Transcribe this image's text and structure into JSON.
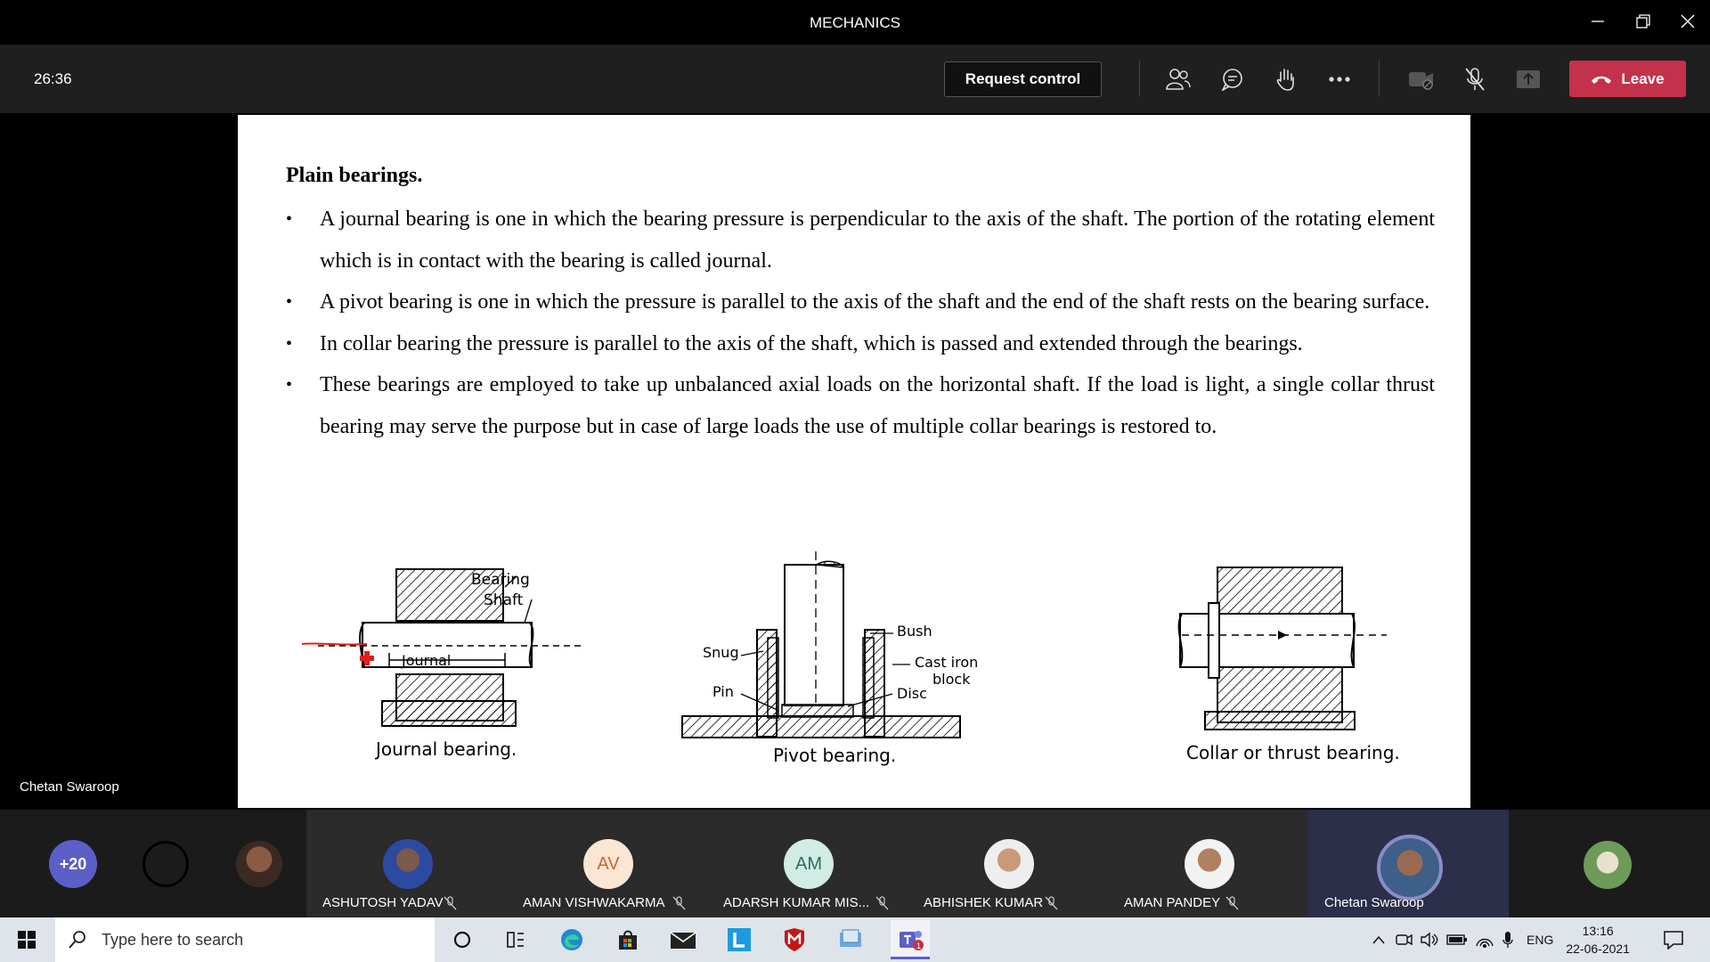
{
  "window": {
    "title": "MECHANICS"
  },
  "toolbar": {
    "timer": "26:36",
    "request_control": "Request control",
    "leave": "Leave",
    "icons": [
      "participants-icon",
      "chat-icon",
      "raise-hand-icon",
      "more-icon",
      "camera-off-icon",
      "mic-muted-icon",
      "share-icon"
    ]
  },
  "stage": {
    "presenter_label": "Chetan Swaroop"
  },
  "slide": {
    "heading": "Plain bearings.",
    "bullets": [
      "A journal bearing is one in which the bearing pressure is perpendicular to the axis of the shaft. The portion of the rotating element which is in contact with the bearing is called journal.",
      "A pivot bearing is one in which the pressure is parallel to the axis of the shaft and the end of the shaft rests on the bearing surface.",
      "In collar bearing the pressure is parallel to the axis of the shaft, which is passed and extended through the bearings.",
      "These bearings are employed to take up unbalanced axial loads on the horizontal shaft. If the load is light, a single collar thrust bearing may serve the purpose but in case of large loads the use of multiple collar bearings is restored to."
    ],
    "diagrams": {
      "journal": {
        "caption": "Journal bearing.",
        "bearing": "Bearing",
        "shaft": "Shaft",
        "journal": "Journal"
      },
      "pivot": {
        "caption": "Pivot bearing.",
        "bush": "Bush",
        "snug": "Snug",
        "cast_iron": "Cast iron",
        "block": "block",
        "pin": "Pin",
        "disc": "Disc"
      },
      "collar": {
        "caption": "Collar or thrust bearing."
      }
    }
  },
  "participants": {
    "overflow": "+20",
    "people": [
      {
        "name": "ASHUTOSH YADAV",
        "initials": "",
        "muted": true
      },
      {
        "name": "AMAN VISHWAKARMA",
        "initials": "AV",
        "muted": true
      },
      {
        "name": "ADARSH KUMAR MIS...",
        "initials": "AM",
        "muted": true
      },
      {
        "name": "ABHISHEK KUMAR",
        "initials": "",
        "muted": true
      },
      {
        "name": "AMAN PANDEY",
        "initials": "",
        "muted": true
      },
      {
        "name": "Chetan Swaroop",
        "initials": "",
        "muted": false
      }
    ]
  },
  "taskbar": {
    "search_placeholder": "Type here to search",
    "language": "ENG",
    "time": "13:16",
    "date": "22-06-2021",
    "teams_badge": "1"
  },
  "colors": {
    "leave": "#c4314b",
    "toolbar": "#1f1f1f",
    "strip": "#1b1b1b",
    "active_ring": "#8b8cc7"
  }
}
